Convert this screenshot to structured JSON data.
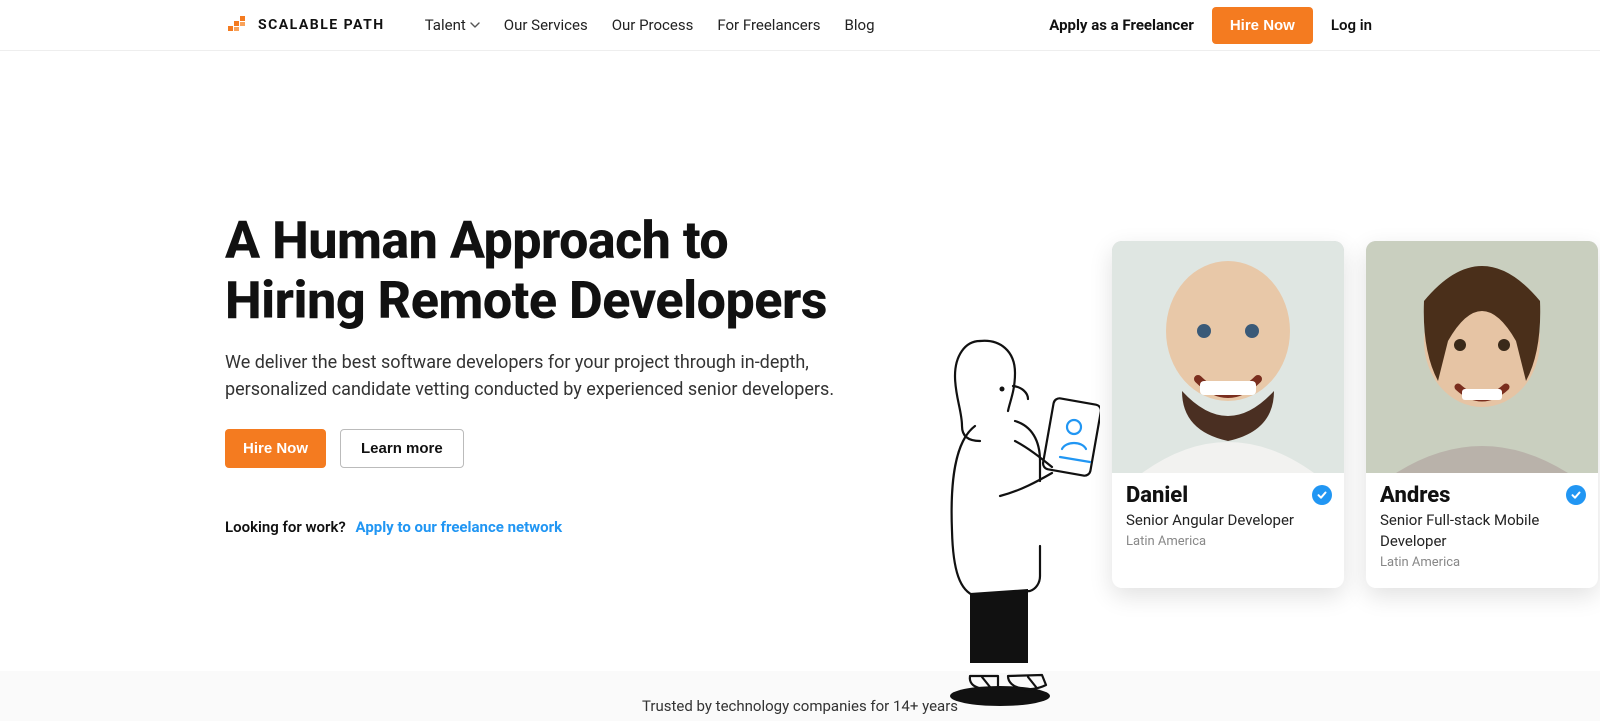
{
  "brand": {
    "name": "SCALABLE PATH"
  },
  "nav": {
    "items": [
      {
        "label": "Talent",
        "has_dropdown": true
      },
      {
        "label": "Our Services",
        "has_dropdown": false
      },
      {
        "label": "Our Process",
        "has_dropdown": false
      },
      {
        "label": "For Freelancers",
        "has_dropdown": false
      },
      {
        "label": "Blog",
        "has_dropdown": false
      }
    ],
    "apply_label": "Apply as a Freelancer",
    "hire_label": "Hire Now",
    "login_label": "Log in"
  },
  "hero": {
    "title_l1": "A Human Approach to",
    "title_l2": "Hiring Remote Developers",
    "subtitle": "We deliver the best software developers for your project through in-depth, personalized candidate vetting conducted by experienced senior developers.",
    "cta_primary": "Hire Now",
    "cta_secondary": "Learn more",
    "looking_prompt": "Looking for work?",
    "looking_link": "Apply to our freelance network"
  },
  "profiles": [
    {
      "name": "Daniel",
      "role": "Senior Angular Developer",
      "region": "Latin America"
    },
    {
      "name": "Andres",
      "role": "Senior Full-stack Mobile Developer",
      "region": "Latin America"
    }
  ],
  "trusted_text": "Trusted by technology companies for 14+ years"
}
